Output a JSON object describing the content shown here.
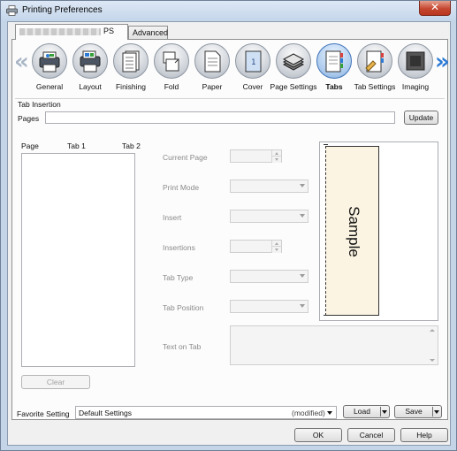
{
  "window": {
    "title": "Printing Preferences",
    "close_glyph": "✕"
  },
  "tabs": [
    {
      "label": "PS"
    },
    {
      "label": "Advanced"
    }
  ],
  "iconbar": {
    "left_arrow": "«",
    "right_arrow": "»",
    "items": [
      {
        "label": "General",
        "icon": "general-icon"
      },
      {
        "label": "Layout",
        "icon": "layout-icon"
      },
      {
        "label": "Finishing",
        "icon": "finishing-icon"
      },
      {
        "label": "Fold",
        "icon": "fold-icon"
      },
      {
        "label": "Paper",
        "icon": "paper-icon"
      },
      {
        "label": "Cover",
        "icon": "cover-icon"
      },
      {
        "label": "Page Settings",
        "icon": "page-settings-icon"
      },
      {
        "label": "Tabs",
        "icon": "tabs-icon",
        "selected": true
      },
      {
        "label": "Tab Settings",
        "icon": "tab-settings-icon"
      },
      {
        "label": "Imaging",
        "icon": "imaging-icon"
      }
    ]
  },
  "tab_insertion": {
    "group_label": "Tab Insertion",
    "pages_label": "Pages",
    "pages_value": "",
    "update_button": "Update"
  },
  "list": {
    "columns": [
      "Page",
      "Tab 1",
      "Tab 2"
    ],
    "clear_button": "Clear"
  },
  "form": {
    "current_page": "Current Page",
    "print_mode": "Print Mode",
    "insert": "Insert",
    "insertions": "Insertions",
    "tab_type": "Tab Type",
    "tab_position": "Tab Position",
    "text_on_tab": "Text on Tab"
  },
  "preview": {
    "sample_text": "Sample"
  },
  "favorite": {
    "label": "Favorite Setting",
    "value": "Default Settings",
    "status": "(modified)",
    "load_button": "Load",
    "save_button": "Save"
  },
  "footer": {
    "ok": "OK",
    "cancel": "Cancel",
    "help": "Help"
  },
  "colors": {
    "selected_icon": "#a9c8ec",
    "right_arrow": "#2b7ad6",
    "close_button": "#c5472f",
    "preview_page": "#fbf4e2"
  }
}
